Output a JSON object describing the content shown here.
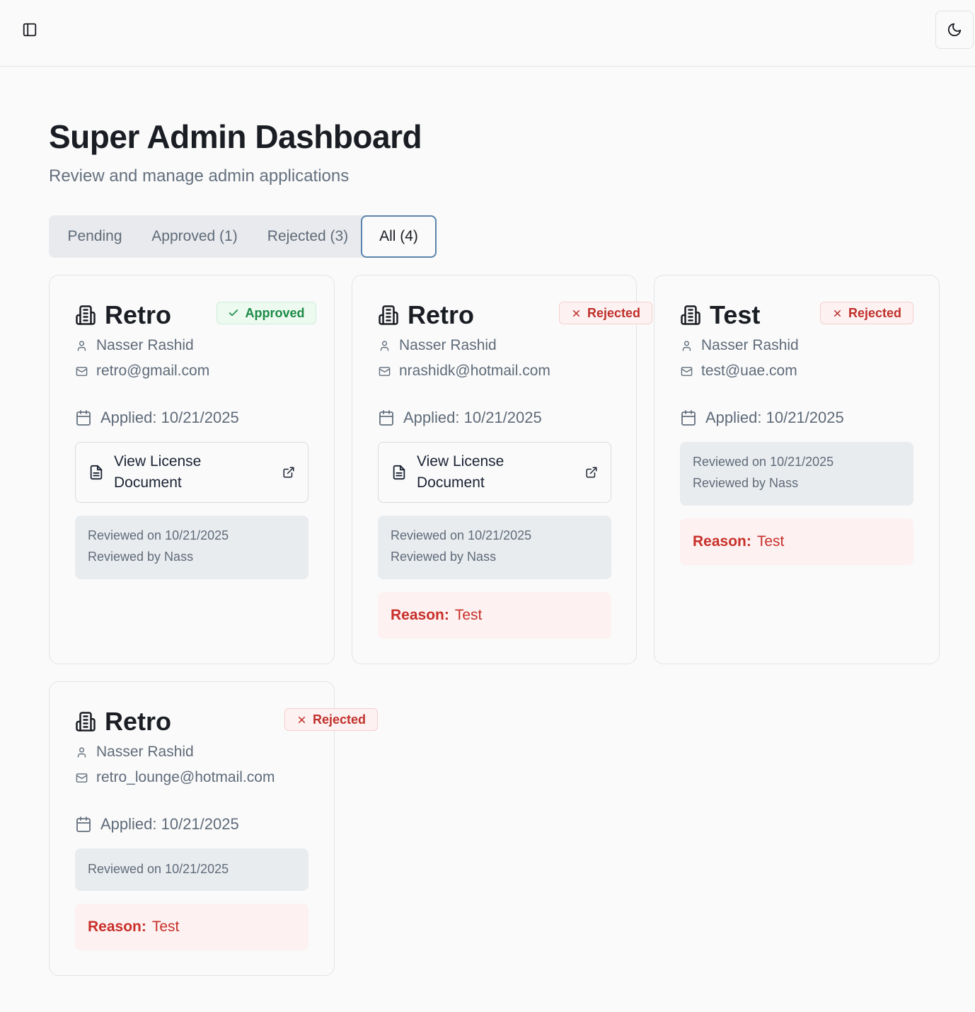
{
  "header": {
    "sidebar_toggle_icon": "panel-left-icon",
    "theme_toggle_icon": "moon-icon"
  },
  "page": {
    "title": "Super Admin Dashboard",
    "subtitle": "Review and manage admin applications"
  },
  "tabs": [
    {
      "label": "Pending",
      "active": false
    },
    {
      "label": "Approved (1)",
      "active": false
    },
    {
      "label": "Rejected (3)",
      "active": false
    },
    {
      "label": "All (4)",
      "active": true
    }
  ],
  "colors": {
    "approved": "#1d8a46",
    "rejected": "#c0302a",
    "active_tab_border": "#5a84ad"
  },
  "applications": [
    {
      "business": "Retro",
      "status": "Approved",
      "status_icon": "check-icon",
      "owner": "Nasser Rashid",
      "email": "retro@gmail.com",
      "applied": "Applied: 10/21/2025",
      "license_button": "View License Document",
      "reviewed_on": "Reviewed on 10/21/2025",
      "reviewed_by": "Reviewed by Nass"
    },
    {
      "business": "Retro",
      "status": "Rejected",
      "status_icon": "x-icon",
      "owner": "Nasser Rashid",
      "email": "nrashidk@hotmail.com",
      "applied": "Applied: 10/21/2025",
      "license_button": "View License Document",
      "reviewed_on": "Reviewed on 10/21/2025",
      "reviewed_by": "Reviewed by Nass",
      "reason_label": "Reason:",
      "reason": "Test"
    },
    {
      "business": "Test",
      "status": "Rejected",
      "status_icon": "x-icon",
      "owner": "Nasser Rashid",
      "email": "test@uae.com",
      "applied": "Applied: 10/21/2025",
      "reviewed_on": "Reviewed on 10/21/2025",
      "reviewed_by": "Reviewed by Nass",
      "reason_label": "Reason:",
      "reason": "Test"
    },
    {
      "business": "Retro",
      "status": "Rejected",
      "status_icon": "x-icon",
      "owner": "Nasser Rashid",
      "email": "retro_lounge@hotmail.com",
      "applied": "Applied: 10/21/2025",
      "reviewed_on": "Reviewed on 10/21/2025",
      "reason_label": "Reason:",
      "reason": "Test"
    }
  ]
}
